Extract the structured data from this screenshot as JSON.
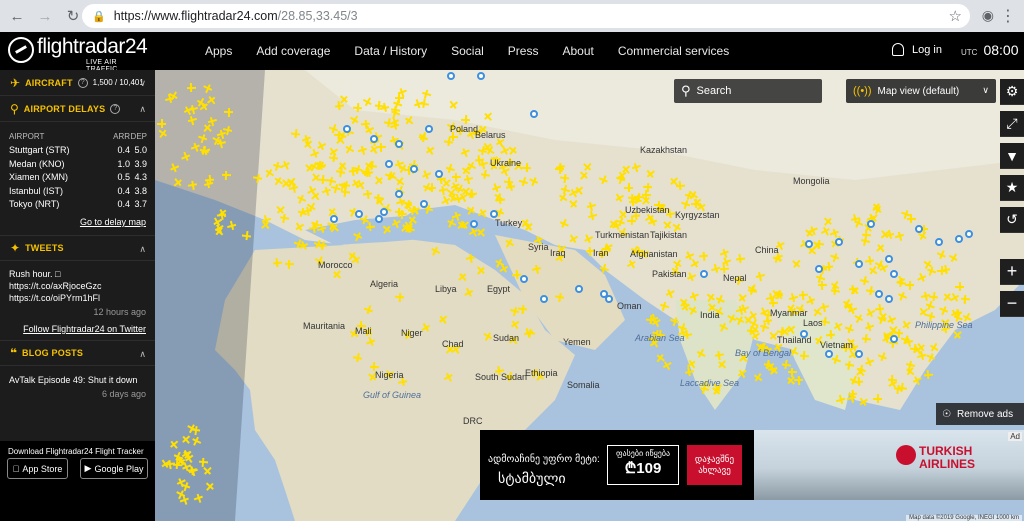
{
  "browser": {
    "url_host": "https://www.flightradar24.com",
    "url_path": "/28.85,33.45/3"
  },
  "header": {
    "logo_text": "flightradar24",
    "logo_sub": "LIVE AIR TRAFFIC",
    "nav": [
      "Apps",
      "Add coverage",
      "Data / History",
      "Social",
      "Press",
      "About",
      "Commercial services"
    ],
    "login": "Log in",
    "tz": "UTC",
    "time": "08:00"
  },
  "sidebar": {
    "aircraft": {
      "title": "AIRCRAFT",
      "count": "1,500 / 10,401"
    },
    "delays": {
      "title": "AIRPORT DELAYS",
      "col_airport": "AIRPORT",
      "col_arr": "ARR",
      "col_dep": "DEP",
      "rows": [
        {
          "airport": "Stuttgart (STR)",
          "arr": "0.4",
          "dep": "5.0"
        },
        {
          "airport": "Medan (KNO)",
          "arr": "1.0",
          "dep": "3.9"
        },
        {
          "airport": "Xiamen (XMN)",
          "arr": "0.5",
          "dep": "4.3"
        },
        {
          "airport": "Istanbul (IST)",
          "arr": "0.4",
          "dep": "3.8"
        },
        {
          "airport": "Tokyo (NRT)",
          "arr": "0.4",
          "dep": "3.7"
        }
      ],
      "link": "Go to delay map"
    },
    "tweets": {
      "title": "TWEETS",
      "line1": "Rush hour. □",
      "line2": "https://t.co/axRjoceGzc",
      "line3": "https://t.co/oiPYrm1hFl",
      "time": "12 hours ago",
      "follow": "Follow Flightradar24 on Twitter"
    },
    "blog": {
      "title": "BLOG POSTS",
      "post": "AvTalk Episode 49: Shut it down",
      "time": "6 days ago"
    },
    "download": {
      "text": "Download Flightradar24 Flight Tracker",
      "app_store": "App Store",
      "google_play": "Google Play"
    }
  },
  "map": {
    "search_label": "Search",
    "mapview_label": "Map view (default)",
    "remove_ads": "Remove ads",
    "labels": [
      "Poland",
      "Ukraine",
      "Belarus",
      "Kazakhstan",
      "Mongolia",
      "Uzbekistan",
      "Turkmenistan",
      "Kyrgyzstan",
      "Tajikistan",
      "Turkey",
      "Syria",
      "Iraq",
      "Iran",
      "Afghanistan",
      "Pakistan",
      "China",
      "India",
      "Nepal",
      "Myanmar",
      "Morocco",
      "Algeria",
      "Libya",
      "Egypt",
      "Mauritania",
      "Mali",
      "Niger",
      "Chad",
      "Sudan",
      "South Sudan",
      "Yemen",
      "Oman",
      "Ethiopia",
      "Somalia",
      "Nigeria",
      "DRC",
      "Philippine Sea",
      "Arabian Sea",
      "Bay of Bengal",
      "Laccadive Sea",
      "Gulf of Guinea",
      "Thailand",
      "Laos",
      "Vietnam"
    ],
    "sea_labels": [
      "Philippine Sea",
      "Arabian Sea",
      "Bay of Bengal",
      "Laccadive Sea",
      "Gulf of Guinea"
    ],
    "attribution": "Map data ©2019 Google, INEGI   1000 km"
  },
  "ad": {
    "geo_line1": "ადმოაჩინე უფრო მეტი:",
    "geo_line2": "სტამბული",
    "price_top": "ფასები იწყება",
    "price": "₾109",
    "button": "დაჯავშნე ახლავე",
    "brand": "TURKISH AIRLINES",
    "ad_tag": "Ad"
  }
}
